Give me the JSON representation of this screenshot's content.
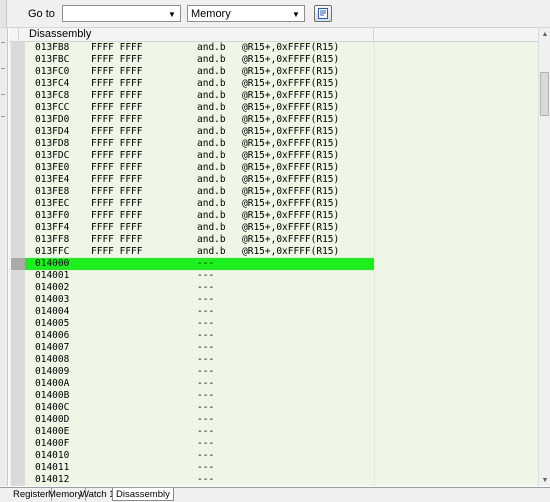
{
  "toolbar": {
    "goto_label": "Go to",
    "goto_value": "",
    "memory_select": "Memory"
  },
  "panel": {
    "title": "Disassembly"
  },
  "disassembly": [
    {
      "addr": "013FB8",
      "opcode": "FFFF FFFF",
      "mnemonic": "and.b",
      "operands": "@R15+,0xFFFF(R15)"
    },
    {
      "addr": "013FBC",
      "opcode": "FFFF FFFF",
      "mnemonic": "and.b",
      "operands": "@R15+,0xFFFF(R15)"
    },
    {
      "addr": "013FC0",
      "opcode": "FFFF FFFF",
      "mnemonic": "and.b",
      "operands": "@R15+,0xFFFF(R15)"
    },
    {
      "addr": "013FC4",
      "opcode": "FFFF FFFF",
      "mnemonic": "and.b",
      "operands": "@R15+,0xFFFF(R15)"
    },
    {
      "addr": "013FC8",
      "opcode": "FFFF FFFF",
      "mnemonic": "and.b",
      "operands": "@R15+,0xFFFF(R15)"
    },
    {
      "addr": "013FCC",
      "opcode": "FFFF FFFF",
      "mnemonic": "and.b",
      "operands": "@R15+,0xFFFF(R15)"
    },
    {
      "addr": "013FD0",
      "opcode": "FFFF FFFF",
      "mnemonic": "and.b",
      "operands": "@R15+,0xFFFF(R15)"
    },
    {
      "addr": "013FD4",
      "opcode": "FFFF FFFF",
      "mnemonic": "and.b",
      "operands": "@R15+,0xFFFF(R15)"
    },
    {
      "addr": "013FD8",
      "opcode": "FFFF FFFF",
      "mnemonic": "and.b",
      "operands": "@R15+,0xFFFF(R15)"
    },
    {
      "addr": "013FDC",
      "opcode": "FFFF FFFF",
      "mnemonic": "and.b",
      "operands": "@R15+,0xFFFF(R15)"
    },
    {
      "addr": "013FE0",
      "opcode": "FFFF FFFF",
      "mnemonic": "and.b",
      "operands": "@R15+,0xFFFF(R15)"
    },
    {
      "addr": "013FE4",
      "opcode": "FFFF FFFF",
      "mnemonic": "and.b",
      "operands": "@R15+,0xFFFF(R15)"
    },
    {
      "addr": "013FE8",
      "opcode": "FFFF FFFF",
      "mnemonic": "and.b",
      "operands": "@R15+,0xFFFF(R15)"
    },
    {
      "addr": "013FEC",
      "opcode": "FFFF FFFF",
      "mnemonic": "and.b",
      "operands": "@R15+,0xFFFF(R15)"
    },
    {
      "addr": "013FF0",
      "opcode": "FFFF FFFF",
      "mnemonic": "and.b",
      "operands": "@R15+,0xFFFF(R15)"
    },
    {
      "addr": "013FF4",
      "opcode": "FFFF FFFF",
      "mnemonic": "and.b",
      "operands": "@R15+,0xFFFF(R15)"
    },
    {
      "addr": "013FF8",
      "opcode": "FFFF FFFF",
      "mnemonic": "and.b",
      "operands": "@R15+,0xFFFF(R15)"
    },
    {
      "addr": "013FFC",
      "opcode": "FFFF FFFF",
      "mnemonic": "and.b",
      "operands": "@R15+,0xFFFF(R15)"
    },
    {
      "addr": "014000",
      "opcode": "",
      "mnemonic": "---",
      "operands": "",
      "current": true
    },
    {
      "addr": "014001",
      "opcode": "",
      "mnemonic": "---",
      "operands": ""
    },
    {
      "addr": "014002",
      "opcode": "",
      "mnemonic": "---",
      "operands": ""
    },
    {
      "addr": "014003",
      "opcode": "",
      "mnemonic": "---",
      "operands": ""
    },
    {
      "addr": "014004",
      "opcode": "",
      "mnemonic": "---",
      "operands": ""
    },
    {
      "addr": "014005",
      "opcode": "",
      "mnemonic": "---",
      "operands": ""
    },
    {
      "addr": "014006",
      "opcode": "",
      "mnemonic": "---",
      "operands": ""
    },
    {
      "addr": "014007",
      "opcode": "",
      "mnemonic": "---",
      "operands": ""
    },
    {
      "addr": "014008",
      "opcode": "",
      "mnemonic": "---",
      "operands": ""
    },
    {
      "addr": "014009",
      "opcode": "",
      "mnemonic": "---",
      "operands": ""
    },
    {
      "addr": "01400A",
      "opcode": "",
      "mnemonic": "---",
      "operands": ""
    },
    {
      "addr": "01400B",
      "opcode": "",
      "mnemonic": "---",
      "operands": ""
    },
    {
      "addr": "01400C",
      "opcode": "",
      "mnemonic": "---",
      "operands": ""
    },
    {
      "addr": "01400D",
      "opcode": "",
      "mnemonic": "---",
      "operands": ""
    },
    {
      "addr": "01400E",
      "opcode": "",
      "mnemonic": "---",
      "operands": ""
    },
    {
      "addr": "01400F",
      "opcode": "",
      "mnemonic": "---",
      "operands": ""
    },
    {
      "addr": "014010",
      "opcode": "",
      "mnemonic": "---",
      "operands": ""
    },
    {
      "addr": "014011",
      "opcode": "",
      "mnemonic": "---",
      "operands": ""
    },
    {
      "addr": "014012",
      "opcode": "",
      "mnemonic": "---",
      "operands": ""
    }
  ],
  "tabs": [
    {
      "label": "Register",
      "active": false
    },
    {
      "label": "Memory",
      "active": false
    },
    {
      "label": "Watch 1",
      "active": false
    },
    {
      "label": "Disassembly",
      "active": true
    }
  ],
  "colors": {
    "panel_bg": "#eef7e6",
    "current_line": "#1cf01c"
  },
  "icons": {
    "goto_button": "goto-page-icon",
    "dropdown": "chevron-down-icon"
  }
}
